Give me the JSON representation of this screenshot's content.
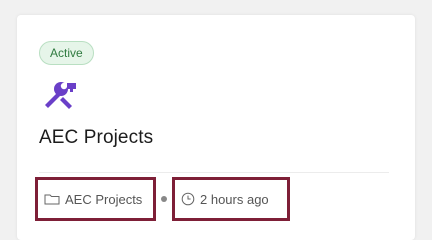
{
  "card": {
    "status_badge": "Active",
    "icon": "tools-icon",
    "title": "AEC Projects",
    "folder": {
      "icon": "folder-icon",
      "label": "AEC Projects"
    },
    "updated": {
      "icon": "clock-icon",
      "label": "2 hours ago"
    }
  },
  "colors": {
    "accent_icon": "#6a3fc8",
    "badge_bg": "#e6f5e9",
    "badge_text": "#2f7a3f",
    "highlight_border": "#7e1f37"
  }
}
